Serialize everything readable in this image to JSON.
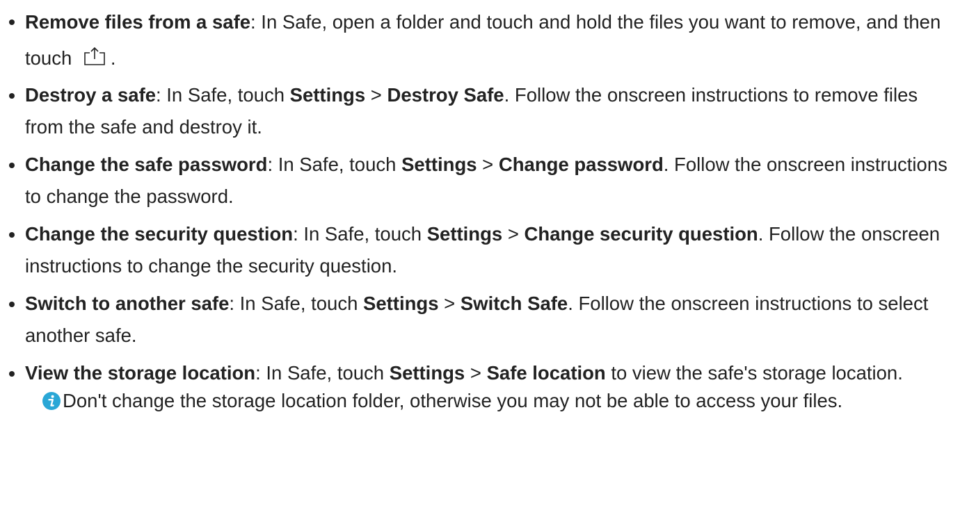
{
  "items": [
    {
      "term": "Remove files from a safe",
      "text_a": ": In Safe, open a folder and touch and hold the files you want to remove, and then touch",
      "text_end": ".",
      "icon": "share-icon"
    },
    {
      "term": "Destroy a safe",
      "text_a": ": In Safe, touch ",
      "bold_1": "Settings",
      "sep": " > ",
      "bold_2": "Destroy Safe",
      "text_b": ". Follow the onscreen instructions to remove files from the safe and destroy it."
    },
    {
      "term": "Change the safe password",
      "text_a": ": In Safe, touch ",
      "bold_1": "Settings",
      "sep": " > ",
      "bold_2": "Change password",
      "text_b": ". Follow the onscreen instructions to change the password."
    },
    {
      "term": "Change the security question",
      "text_a": ": In Safe, touch ",
      "bold_1": "Settings",
      "sep": " > ",
      "bold_2": "Change security question",
      "text_b": ". Follow the onscreen instructions to change the security question."
    },
    {
      "term": "Switch to another safe",
      "text_a": ": In Safe, touch ",
      "bold_1": "Settings",
      "sep": " > ",
      "bold_2": "Switch Safe",
      "text_b": ". Follow the onscreen instructions to select another safe."
    },
    {
      "term": "View the storage location",
      "text_a": ": In Safe, touch ",
      "bold_1": "Settings",
      "sep": " > ",
      "bold_2": "Safe location",
      "text_b": " to view the safe's storage location."
    }
  ],
  "note": {
    "icon": "info-icon",
    "text": "Don't change the storage location folder, otherwise you may not be able to access your files."
  },
  "colors": {
    "text": "#222222",
    "info_icon": "#2aa7d6"
  }
}
